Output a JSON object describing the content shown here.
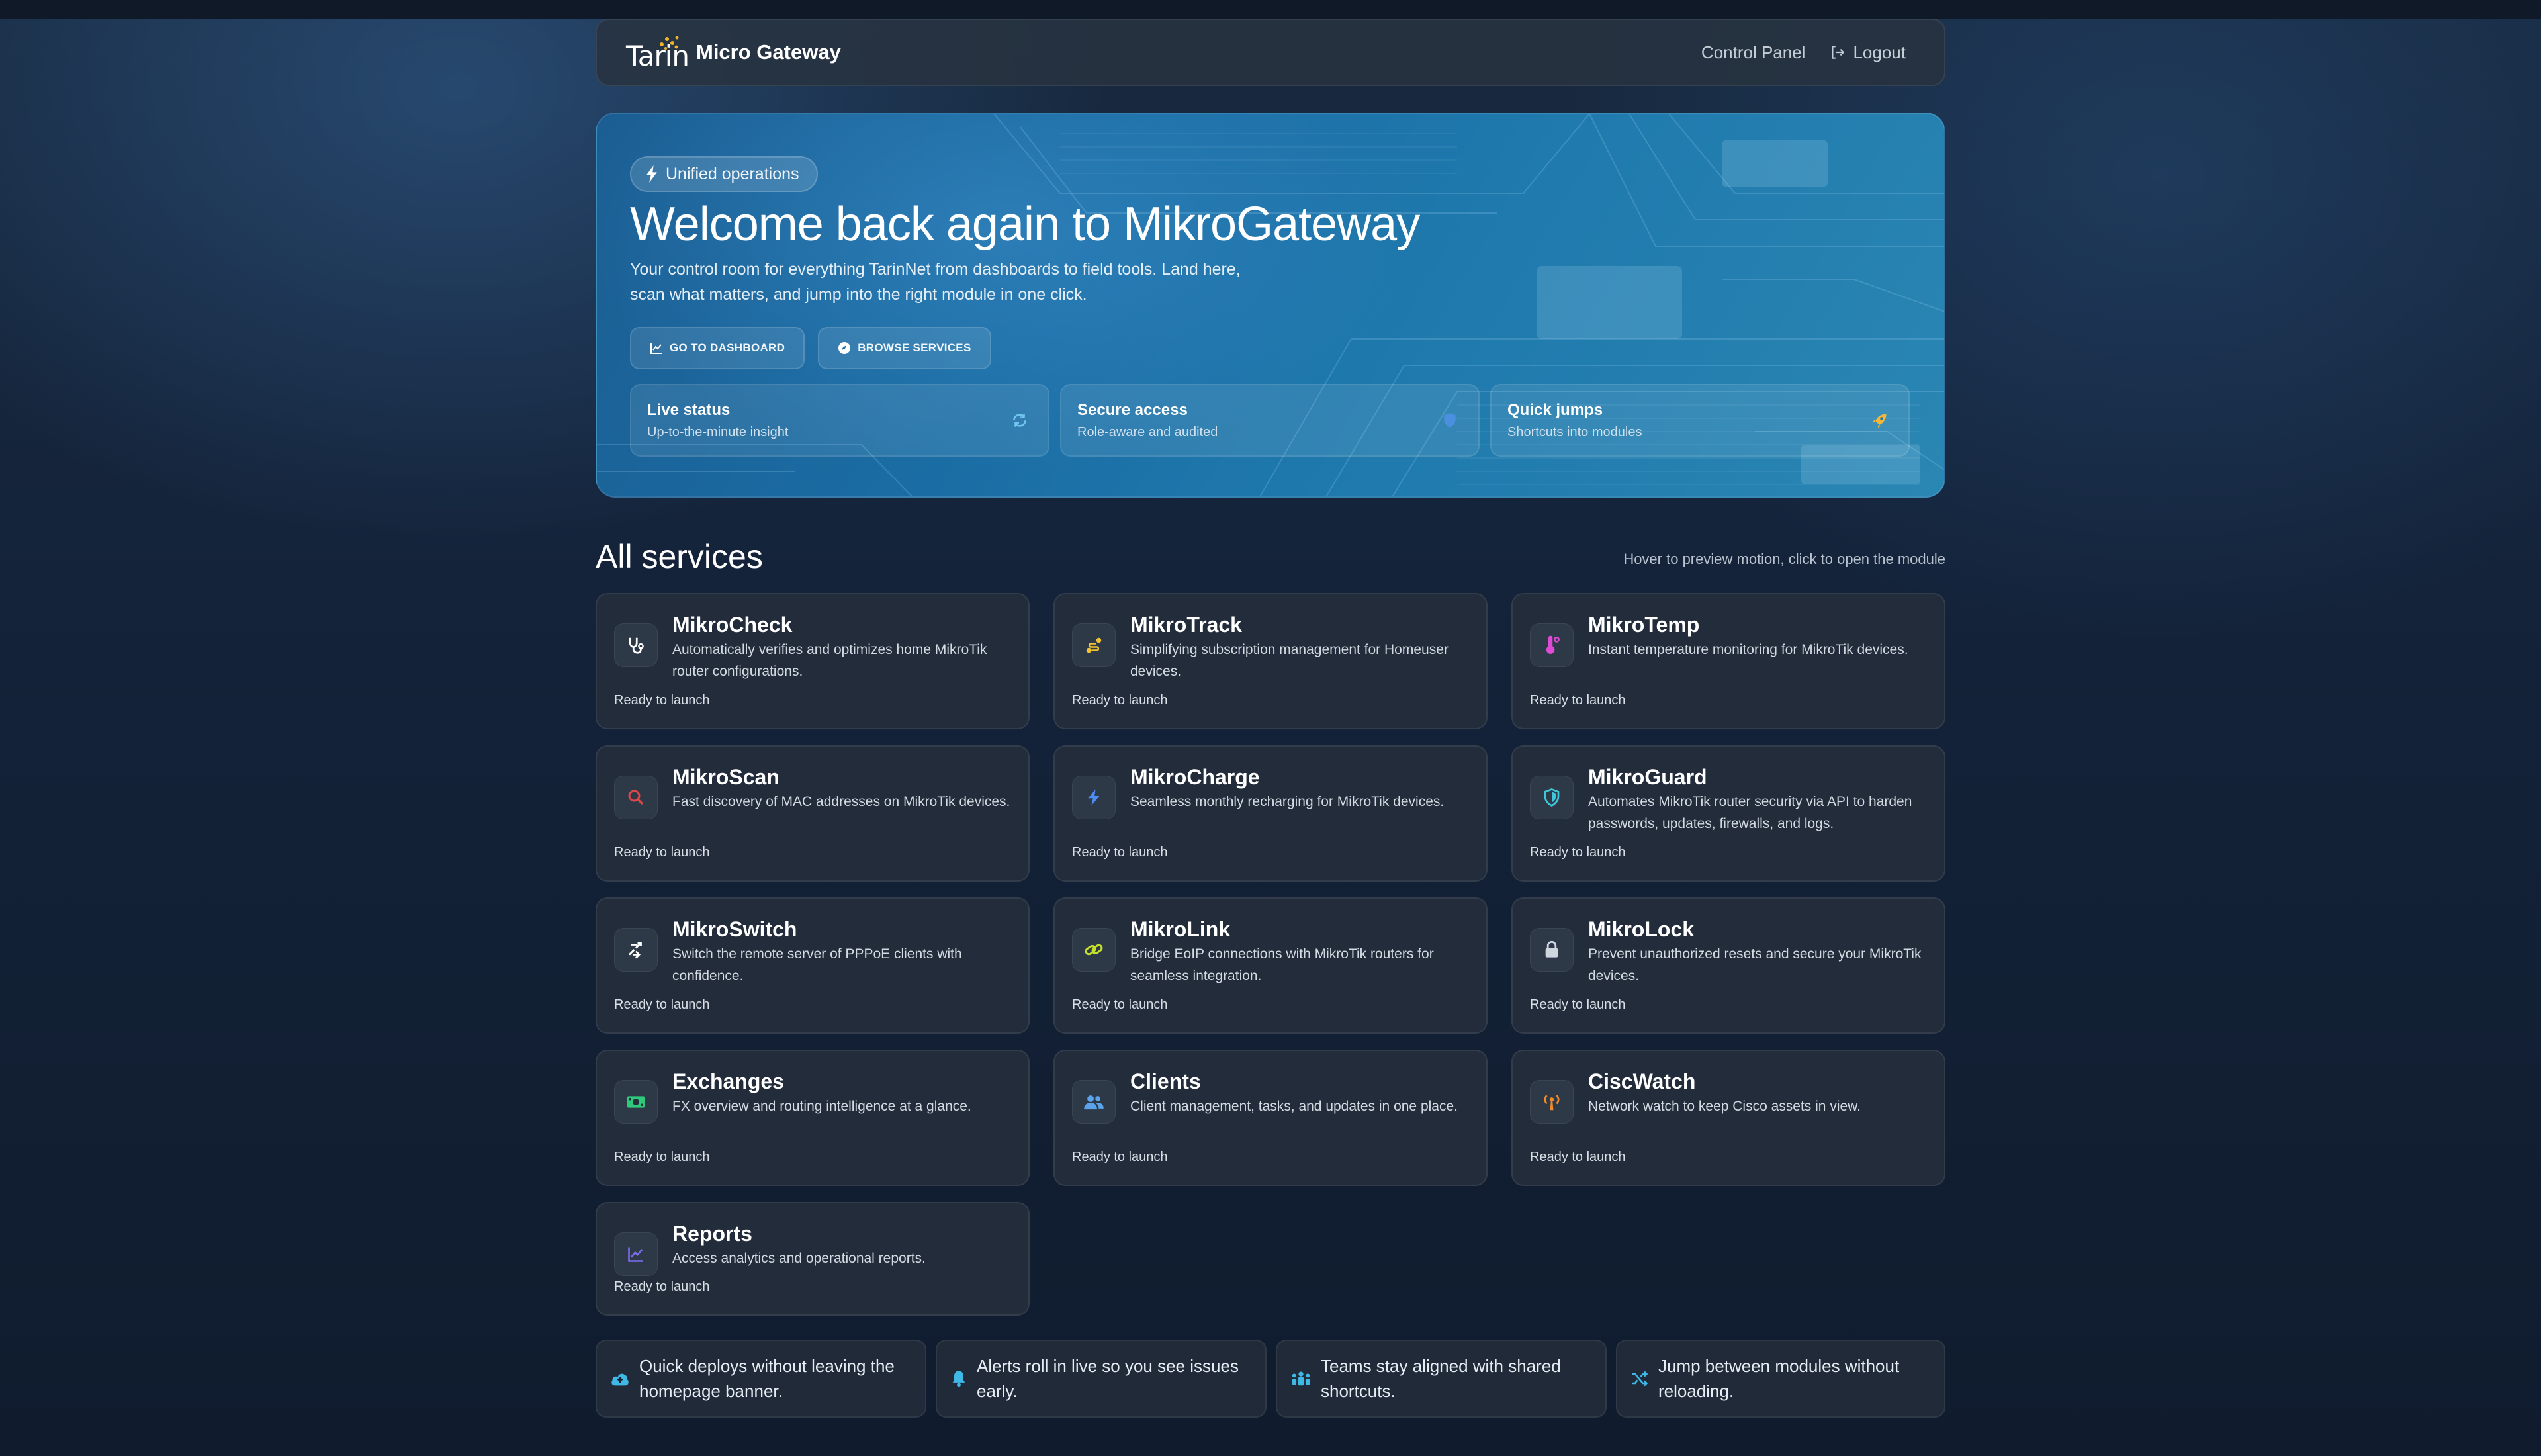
{
  "header": {
    "logo_text": "Tarin",
    "brand": "Micro Gateway",
    "nav": [
      {
        "label": "Control Panel",
        "icon": "none"
      },
      {
        "label": "Logout",
        "icon": "logout-icon"
      }
    ]
  },
  "hero": {
    "badge": "Unified operations",
    "title": "Welcome back again to MikroGateway",
    "subtitle": "Your control room for everything TarinNet from dashboards to field tools. Land here, scan what matters, and jump into the right module in one click.",
    "buttons": [
      {
        "label": "GO TO DASHBOARD",
        "icon": "chart-line-icon"
      },
      {
        "label": "BROWSE SERVICES",
        "icon": "compass-icon"
      }
    ],
    "features": [
      {
        "title": "Live status",
        "subtitle": "Up-to-the-minute insight",
        "icon": "sync-icon"
      },
      {
        "title": "Secure access",
        "subtitle": "Role-aware and audited",
        "icon": "shield-icon"
      },
      {
        "title": "Quick jumps",
        "subtitle": "Shortcuts into modules",
        "icon": "rocket-icon"
      }
    ]
  },
  "services": {
    "heading": "All services",
    "hint": "Hover to preview motion, click to open the module",
    "items": [
      {
        "name": "MikroCheck",
        "desc": "Automatically verifies and optimizes home MikroTik router configurations.",
        "status": "Ready to launch",
        "icon": "stethoscope-icon",
        "color": "#ffffff"
      },
      {
        "name": "MikroTrack",
        "desc": "Simplifying subscription management for Homeuser devices.",
        "status": "Ready to launch",
        "icon": "route-icon",
        "color": "#f1c232"
      },
      {
        "name": "MikroTemp",
        "desc": "Instant temperature monitoring for MikroTik devices.",
        "status": "Ready to launch",
        "icon": "thermometer-icon",
        "color": "#e04bd6"
      },
      {
        "name": "MikroScan",
        "desc": "Fast discovery of MAC addresses on MikroTik devices.",
        "status": "Ready to launch",
        "icon": "search-icon",
        "color": "#e04848"
      },
      {
        "name": "MikroCharge",
        "desc": "Seamless monthly recharging for MikroTik devices.",
        "status": "Ready to launch",
        "icon": "bolt-icon",
        "color": "#4d8ef5"
      },
      {
        "name": "MikroGuard",
        "desc": "Automates MikroTik router security via API to harden passwords, updates, firewalls, and logs.",
        "status": "Ready to launch",
        "icon": "shield-icon",
        "color": "#3fc6d8"
      },
      {
        "name": "MikroSwitch",
        "desc": "Switch the remote server of PPPoE clients with confidence.",
        "status": "Ready to launch",
        "icon": "shuffle-arrows-icon",
        "color": "#ffffff"
      },
      {
        "name": "MikroLink",
        "desc": "Bridge EoIP connections with MikroTik routers for seamless integration.",
        "status": "Ready to launch",
        "icon": "link-icon",
        "color": "#c4e02a"
      },
      {
        "name": "MikroLock",
        "desc": "Prevent unauthorized resets and secure your MikroTik devices.",
        "status": "Ready to launch",
        "icon": "lock-icon",
        "color": "#d0d6de"
      },
      {
        "name": "Exchanges",
        "desc": "FX overview and routing intelligence at a glance.",
        "status": "Ready to launch",
        "icon": "money-bill-icon",
        "color": "#2fc97a"
      },
      {
        "name": "Clients",
        "desc": "Client management, tasks, and updates in one place.",
        "status": "Ready to launch",
        "icon": "users-icon",
        "color": "#5aa2ea"
      },
      {
        "name": "CiscWatch",
        "desc": "Network watch to keep Cisco assets in view.",
        "status": "Ready to launch",
        "icon": "tower-broadcast-icon",
        "color": "#f08a2a"
      },
      {
        "name": "Reports",
        "desc": "Access analytics and operational reports.",
        "status": "Ready to launch",
        "icon": "chart-line-icon",
        "color": "#7d6ef0"
      }
    ]
  },
  "tips": [
    {
      "text": "Quick deploys without leaving the homepage banner.",
      "icon": "cloud-upload-icon"
    },
    {
      "text": "Alerts roll in live so you see issues early.",
      "icon": "bell-icon"
    },
    {
      "text": "Teams stay aligned with shared shortcuts.",
      "icon": "people-group-icon"
    },
    {
      "text": "Jump between modules without reloading.",
      "icon": "shuffle-icon"
    }
  ],
  "colors": {
    "accent": "#3fb8e6",
    "hero": "#1b6ea6",
    "card": "#242e3c"
  }
}
